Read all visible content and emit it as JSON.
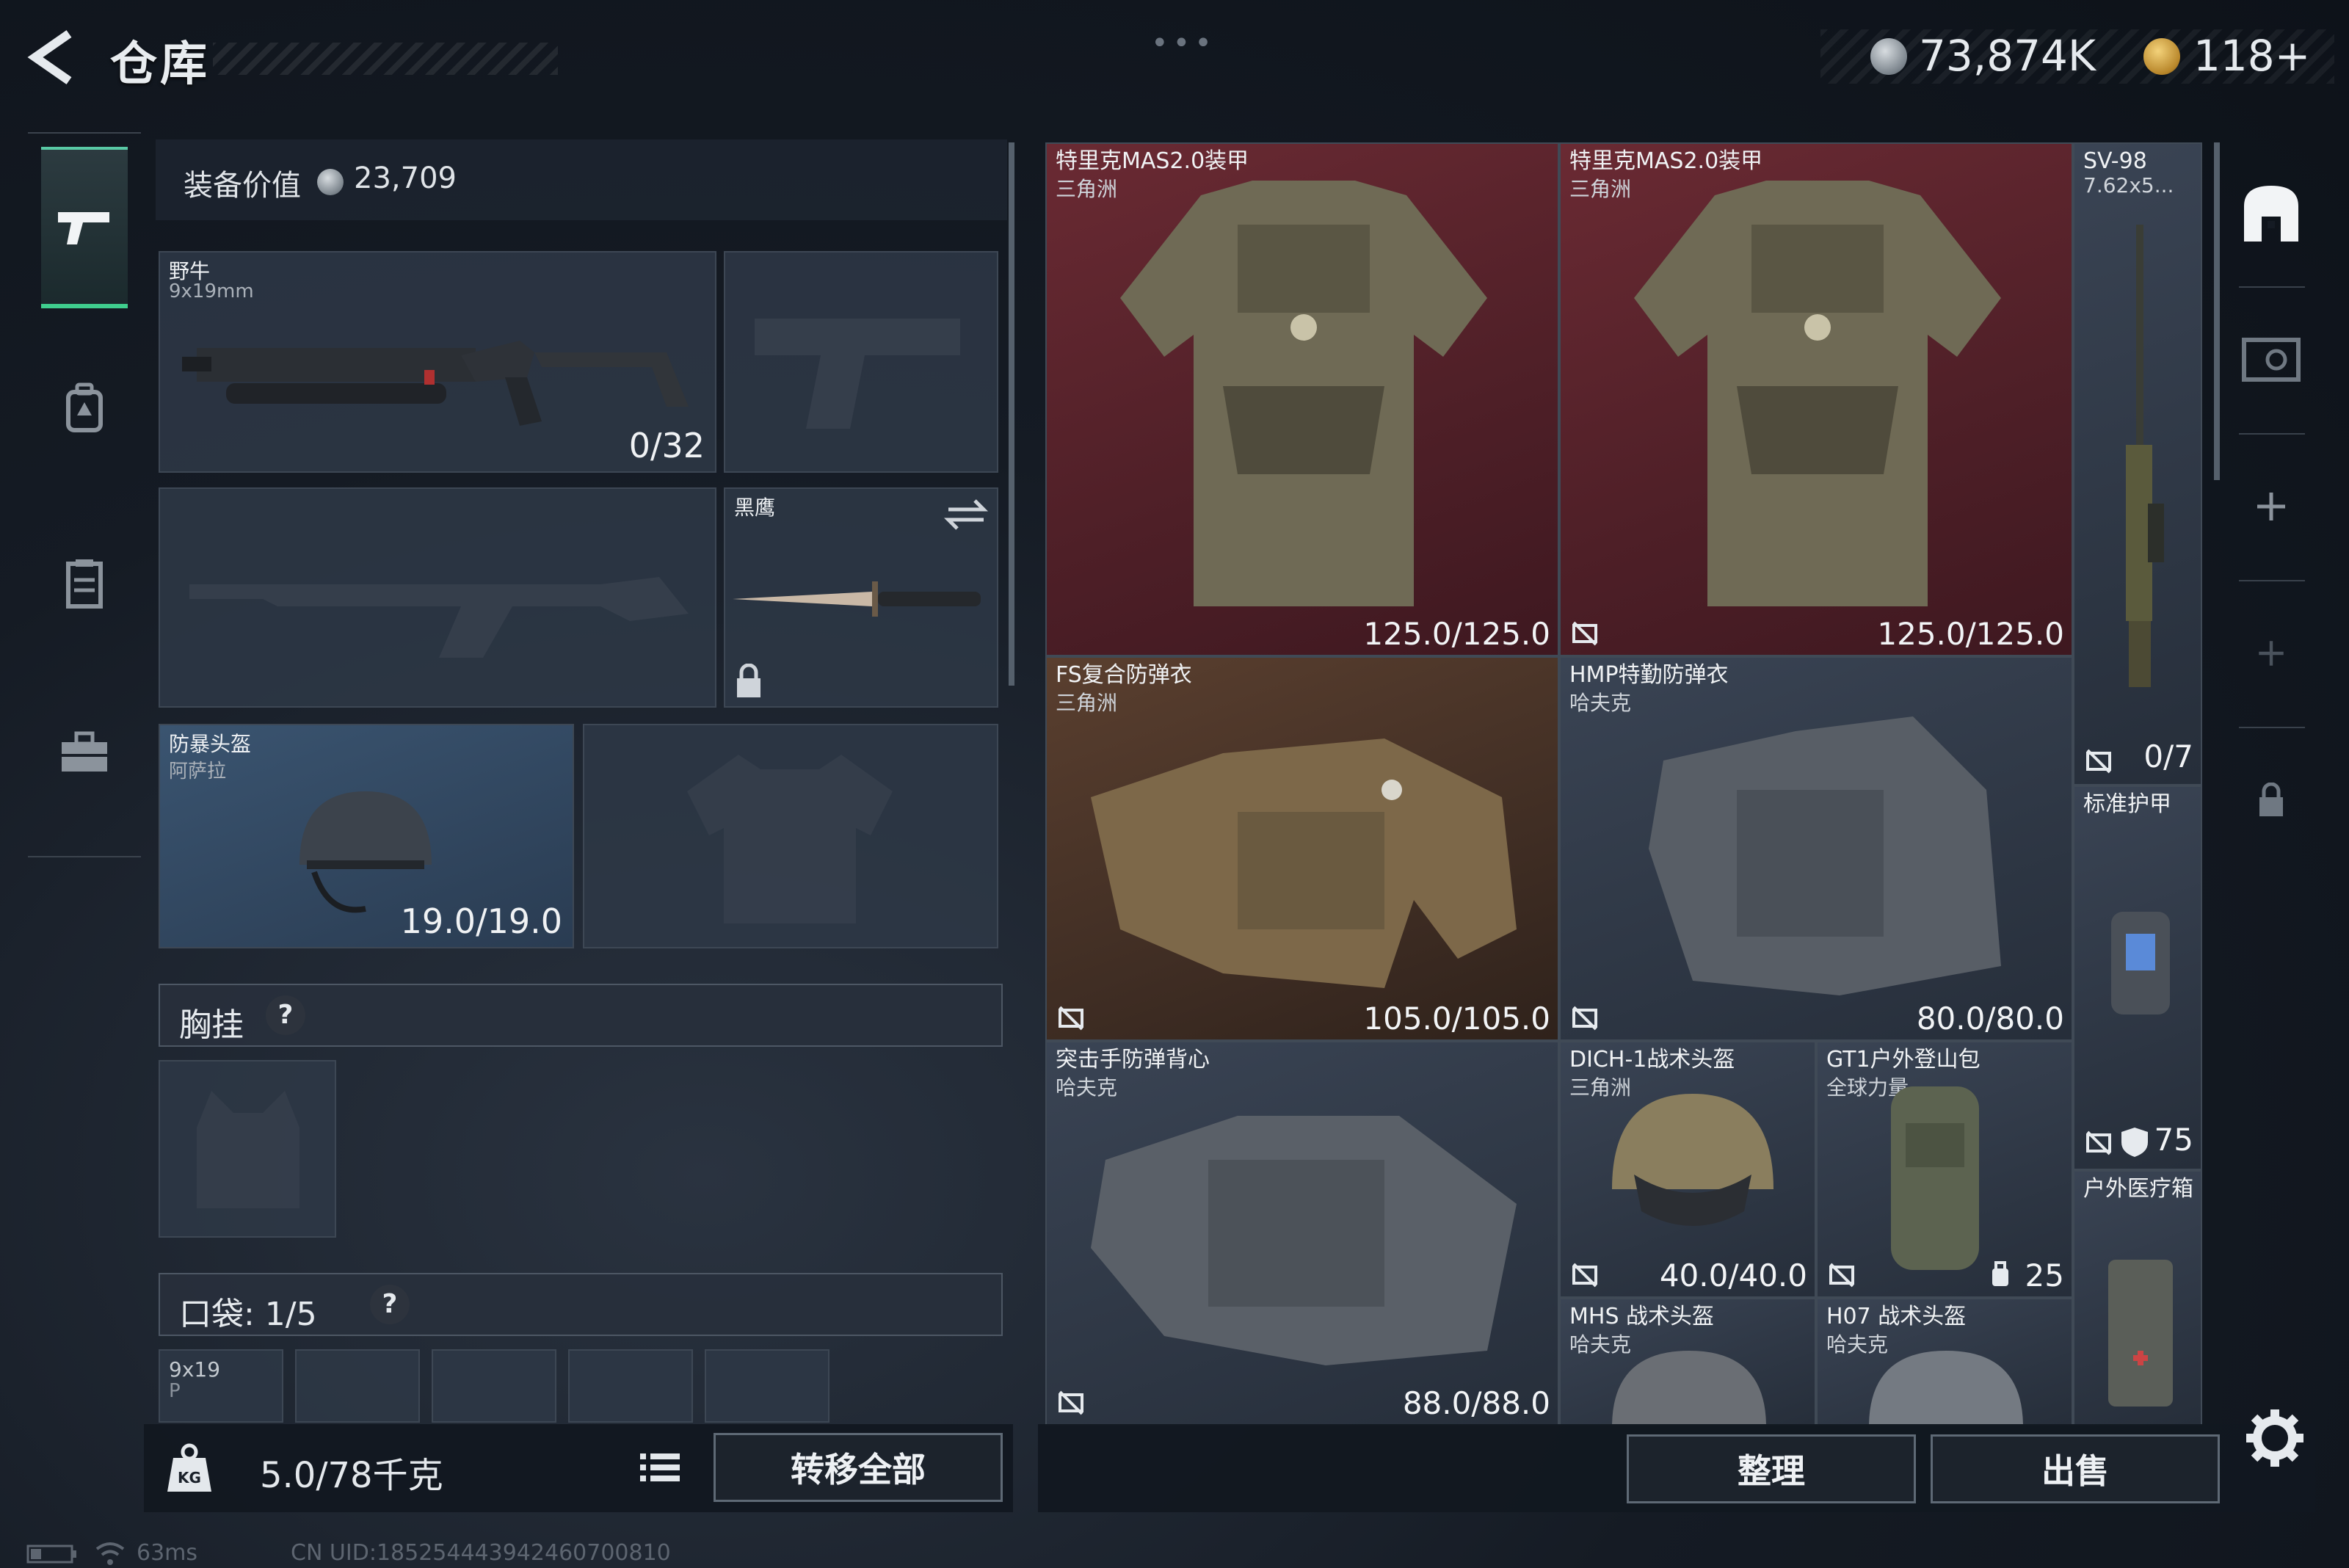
{
  "header": {
    "title": "仓库",
    "silver_amount": "73,874K",
    "gold_amount": "118+"
  },
  "equipment": {
    "value_label": "装备价值",
    "value_amount": "23,709",
    "primary_weapon": {
      "name": "野牛",
      "caliber": "9x19mm",
      "ammo": "0/32"
    },
    "melee": {
      "name": "黑鹰"
    },
    "helmet": {
      "name": "防暴头盔",
      "origin": "阿萨拉",
      "durability": "19.0/19.0"
    },
    "chest_rig_label": "胸挂",
    "pockets_label": "口袋: 1/5",
    "pocket_item": {
      "caliber": "9x19",
      "abbr": "P"
    }
  },
  "footer_left": {
    "weight": "5.0/78千克",
    "transfer_all": "转移全部"
  },
  "storage": {
    "items": [
      {
        "name": "特里克MAS2.0装甲",
        "origin": "三角洲",
        "value": "125.0/125.0"
      },
      {
        "name": "特里克MAS2.0装甲",
        "origin": "三角洲",
        "value": "125.0/125.0"
      },
      {
        "name": "SV-98",
        "origin": "7.62x5...",
        "value": "0/7"
      },
      {
        "name": "FS复合防弹衣",
        "origin": "三角洲",
        "value": "105.0/105.0"
      },
      {
        "name": "HMP特勤防弹衣",
        "origin": "哈夫克",
        "value": "80.0/80.0"
      },
      {
        "name": "标准护甲",
        "origin": "",
        "value": "75"
      },
      {
        "name": "突击手防弹背心",
        "origin": "哈夫克",
        "value": "88.0/88.0"
      },
      {
        "name": "DICH-1战术头盔",
        "origin": "三角洲",
        "value": "40.0/40.0"
      },
      {
        "name": "GT1户外登山包",
        "origin": "全球力量",
        "value": "25"
      },
      {
        "name": "户外医疗箱",
        "origin": "",
        "value": ""
      },
      {
        "name": "MHS 战术头盔",
        "origin": "哈夫克",
        "value": ""
      },
      {
        "name": "H07 战术头盔",
        "origin": "哈夫克",
        "value": ""
      }
    ]
  },
  "footer_right": {
    "sort": "整理",
    "sell": "出售"
  },
  "status": {
    "ping": "63ms",
    "uid": "CN UID:185254443942460700810"
  },
  "colors": {
    "accent_green": "#3fcf8e",
    "cell_red": "#6a2a33",
    "cell_brown": "#5a3f2f",
    "cell_slate": "#3a4454"
  },
  "icons": {
    "nav": [
      "pistol-icon",
      "backpack-icon",
      "chest-rig-icon",
      "briefcase-icon"
    ],
    "rail": [
      "storage-home-icon",
      "safe-box-icon",
      "add-icon",
      "add-icon",
      "lock-icon"
    ]
  }
}
